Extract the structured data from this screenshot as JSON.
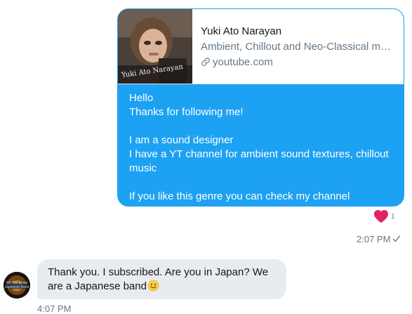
{
  "link_preview": {
    "title": "Yuki Ato Narayan",
    "description": "Ambient, Chillout and Neo-Classical music",
    "domain": "youtube.com",
    "thumbnail_caption": "Yuki Ato Narayan"
  },
  "outgoing_message": {
    "lines": [
      "Hello",
      "Thanks for following me!",
      "",
      "I am a sound designer",
      "I have a YT channel for ambient sound textures, chillout music",
      "",
      "If you like this genre you can check  my  channel"
    ],
    "likes": "1",
    "time": "2:07 PM",
    "accent_color": "#1da1f2",
    "heart_color": "#e0245e"
  },
  "incoming_message": {
    "text": "Thank you. I subscribed. Are you in Japan? We are a Japanese band",
    "emoji": "slightly-smiling-face",
    "time": "4:07 PM",
    "avatar_caption": "Kill The Beast Japanese Band"
  }
}
